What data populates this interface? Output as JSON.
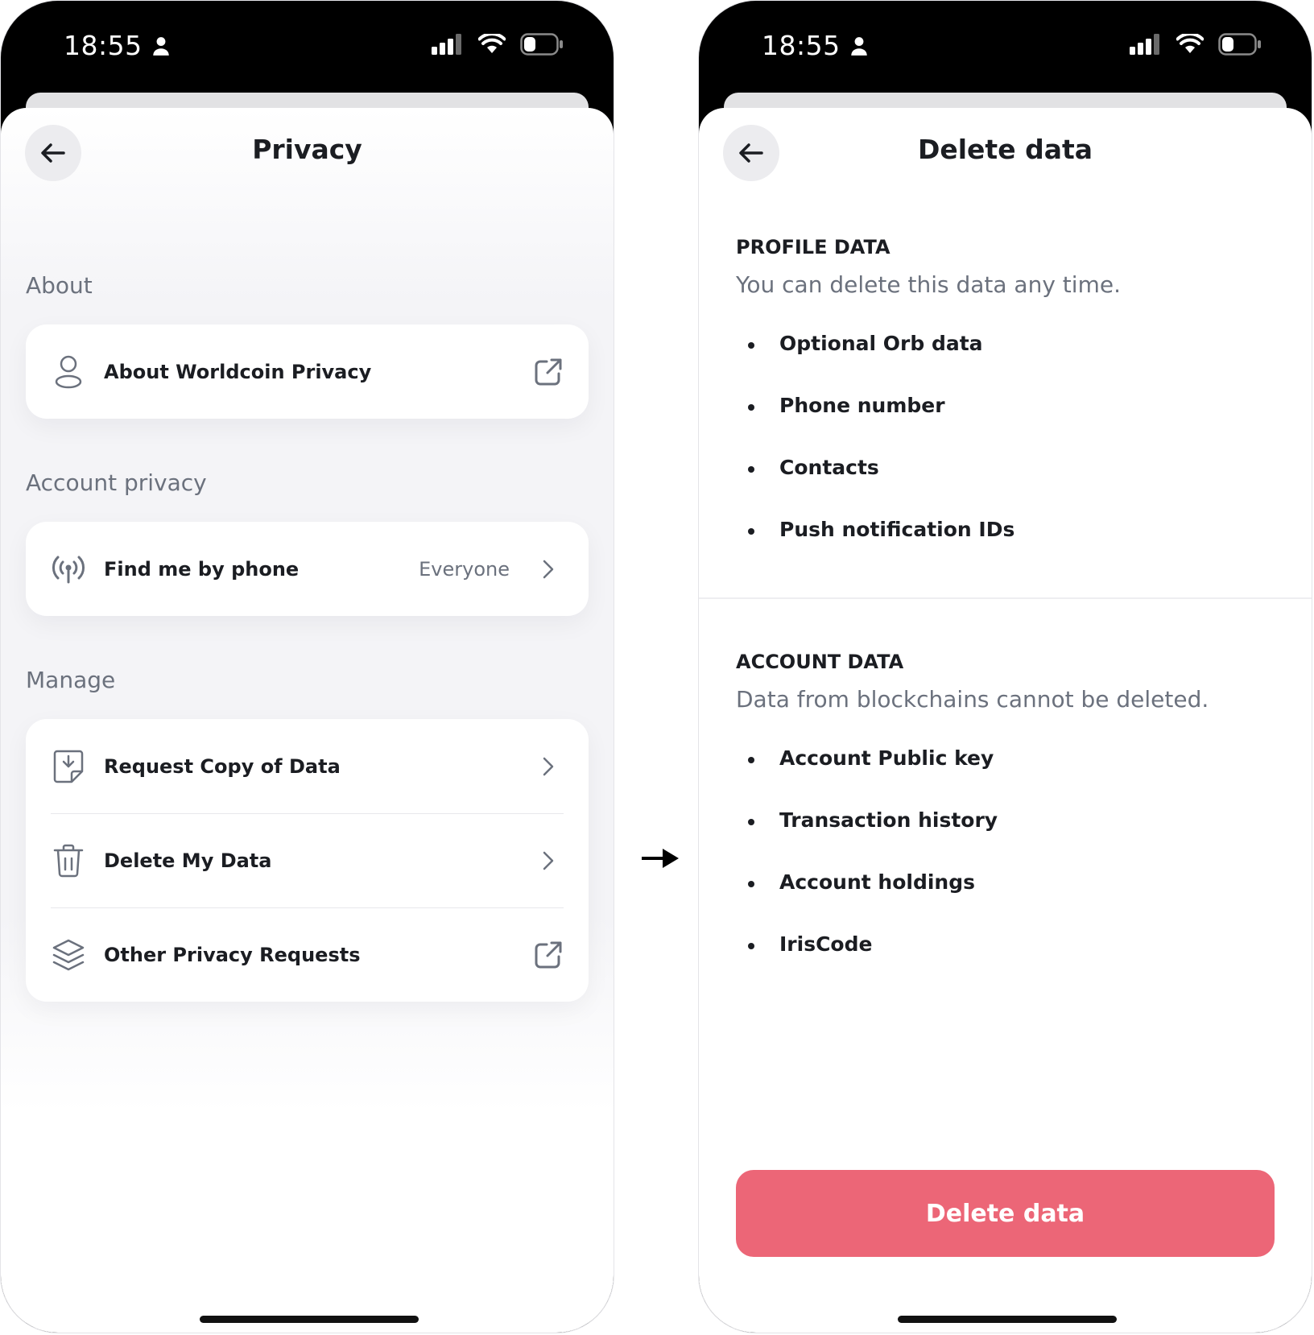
{
  "left_screen": {
    "status_bar": {
      "time": "18:55"
    },
    "title": "Privacy",
    "sections": [
      {
        "label": "About",
        "items": [
          {
            "label": "About Worldcoin Privacy",
            "icon": "person-icon",
            "trailing": "external-link-icon"
          }
        ]
      },
      {
        "label": "Account privacy",
        "items": [
          {
            "label": "Find me by phone",
            "value": "Everyone",
            "icon": "broadcast-icon",
            "trailing": "chevron-right-icon"
          }
        ]
      },
      {
        "label": "Manage",
        "items": [
          {
            "label": "Request Copy of Data",
            "icon": "download-document-icon",
            "trailing": "chevron-right-icon"
          },
          {
            "label": "Delete My Data",
            "icon": "trash-icon",
            "trailing": "chevron-right-icon"
          },
          {
            "label": "Other Privacy Requests",
            "icon": "layers-icon",
            "trailing": "external-link-icon"
          }
        ]
      }
    ]
  },
  "right_screen": {
    "status_bar": {
      "time": "18:55"
    },
    "title": "Delete data",
    "profile": {
      "heading": "PROFILE DATA",
      "subtitle": "You can delete this data any time.",
      "items": [
        "Optional Orb data",
        "Phone number",
        "Contacts",
        "Push notification IDs"
      ]
    },
    "account": {
      "heading": "ACCOUNT DATA",
      "subtitle": "Data from blockchains cannot be deleted.",
      "items": [
        "Account Public key",
        "Transaction history",
        "Account holdings",
        "IrisCode"
      ]
    },
    "button_label": "Delete data"
  },
  "colors": {
    "accent_delete": "#ec6677",
    "muted_text": "#6b717d",
    "primary_text": "#1b1d22"
  }
}
